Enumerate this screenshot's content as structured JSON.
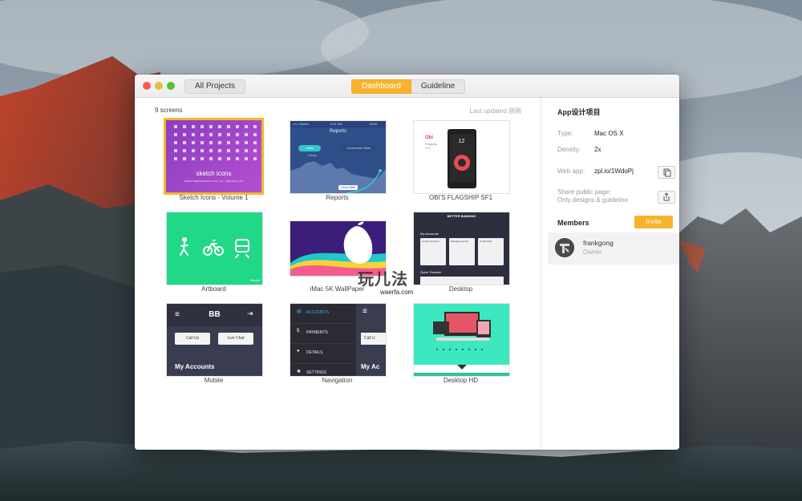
{
  "window": {
    "nav": {
      "all_projects": "All Projects"
    },
    "tabs": [
      {
        "label": "Dashboard",
        "active": true
      },
      {
        "label": "Guideline",
        "active": false
      }
    ]
  },
  "main": {
    "screen_count": "9 screens",
    "last_updated": "Last updated 刚刚",
    "screens": [
      {
        "name": "Sketch Icons - Volume 1",
        "selected": true,
        "thumb_caption": "sketch icons",
        "thumb_sub": "sketchappsources.com / ••• / @icons_ma"
      },
      {
        "name": "Reports",
        "selected": false,
        "status_left": "••••• Sketch",
        "status_time": "9:41 AM",
        "status_right": "100%",
        "header": "Reports",
        "pill_left": "Visits",
        "pill_right": "Conversion Rate",
        "sub_label": "Clicks",
        "tooltip": "Clicks 3886"
      },
      {
        "name": "OBI'S FLAGSHIP SF1",
        "selected": false,
        "brand": "Obi",
        "line1": "Flagship",
        "line2": "SF1",
        "phone_time": "12"
      },
      {
        "name": "Artboard",
        "selected": false,
        "corner": "Sketch"
      },
      {
        "name": "iMac 5K WallPaper",
        "selected": false
      },
      {
        "name": "Desktop",
        "selected": false,
        "brand": "BETTER BANKING",
        "section": "My Accounts",
        "quick": "Quick Transfer",
        "acc1": "Current Account",
        "acc2": "Savings Account",
        "acc3": "Credit Card"
      },
      {
        "name": "Mobile",
        "selected": false,
        "brand": "BB",
        "call": "Call Us",
        "chat": "Live Chat",
        "accounts": "My Accounts"
      },
      {
        "name": "Navigation",
        "selected": false,
        "items": [
          "ACCOUNTS",
          "PAYMENTS",
          "DETAILS",
          "SETTINGS"
        ],
        "call": "Call U",
        "accounts": "My Ac"
      },
      {
        "name": "Desktop HD",
        "selected": false
      }
    ]
  },
  "sidebar": {
    "project_name": "App设计项目",
    "type_label": "Type:",
    "type_value": "Mac OS X",
    "density_label": "Density:",
    "density_value": "2x",
    "webapp_label": "Web app:",
    "webapp_value": "zpl.io/1WdoPj",
    "share_label": "Share public page:",
    "share_value": "Only designs & guideline",
    "members_title": "Members",
    "invite_label": "Invite",
    "members": [
      {
        "name": "frankgong",
        "role": "Owner"
      }
    ]
  },
  "watermark": {
    "text": "玩儿法",
    "sub": "waerfa.com"
  },
  "colors": {
    "accent": "#f7b32b",
    "close": "#fc5b57",
    "minimize": "#e5bf3c",
    "maximize": "#57c038"
  }
}
